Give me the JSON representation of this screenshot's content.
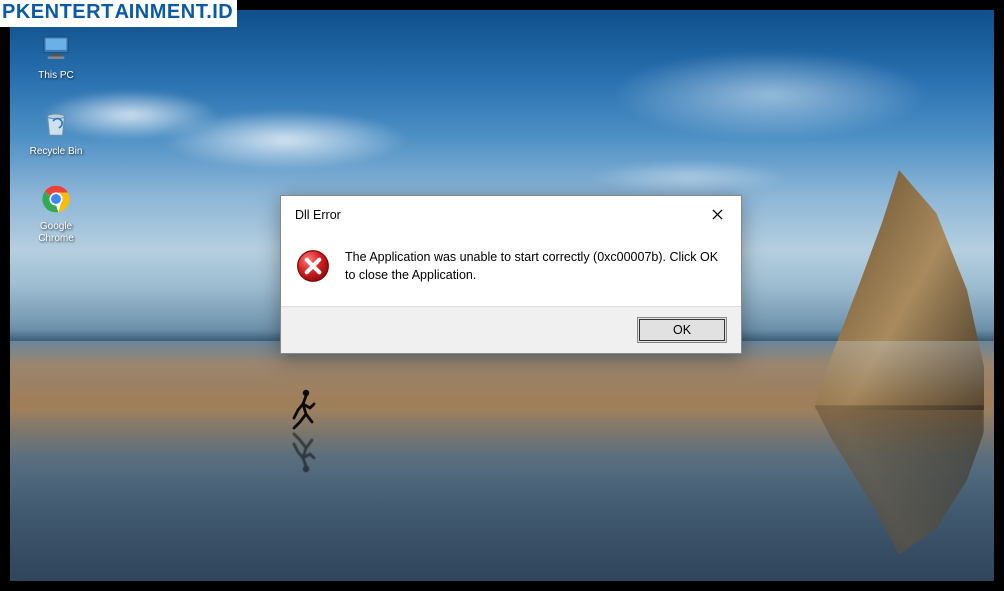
{
  "watermark": {
    "text_part1": "PKENTERT",
    "text_flip": "A",
    "text_part2": "INMENT.ID"
  },
  "desktop": {
    "icons": [
      {
        "name": "this-pc",
        "label": "This PC"
      },
      {
        "name": "recycle-bin",
        "label": "Recycle Bin"
      },
      {
        "name": "google-chrome",
        "label": "Google\nChrome"
      }
    ]
  },
  "dialog": {
    "title": "Dll Error",
    "message": "The Application was unable to start correctly (0xc00007b). Click OK to close the Application.",
    "ok_label": "OK"
  }
}
